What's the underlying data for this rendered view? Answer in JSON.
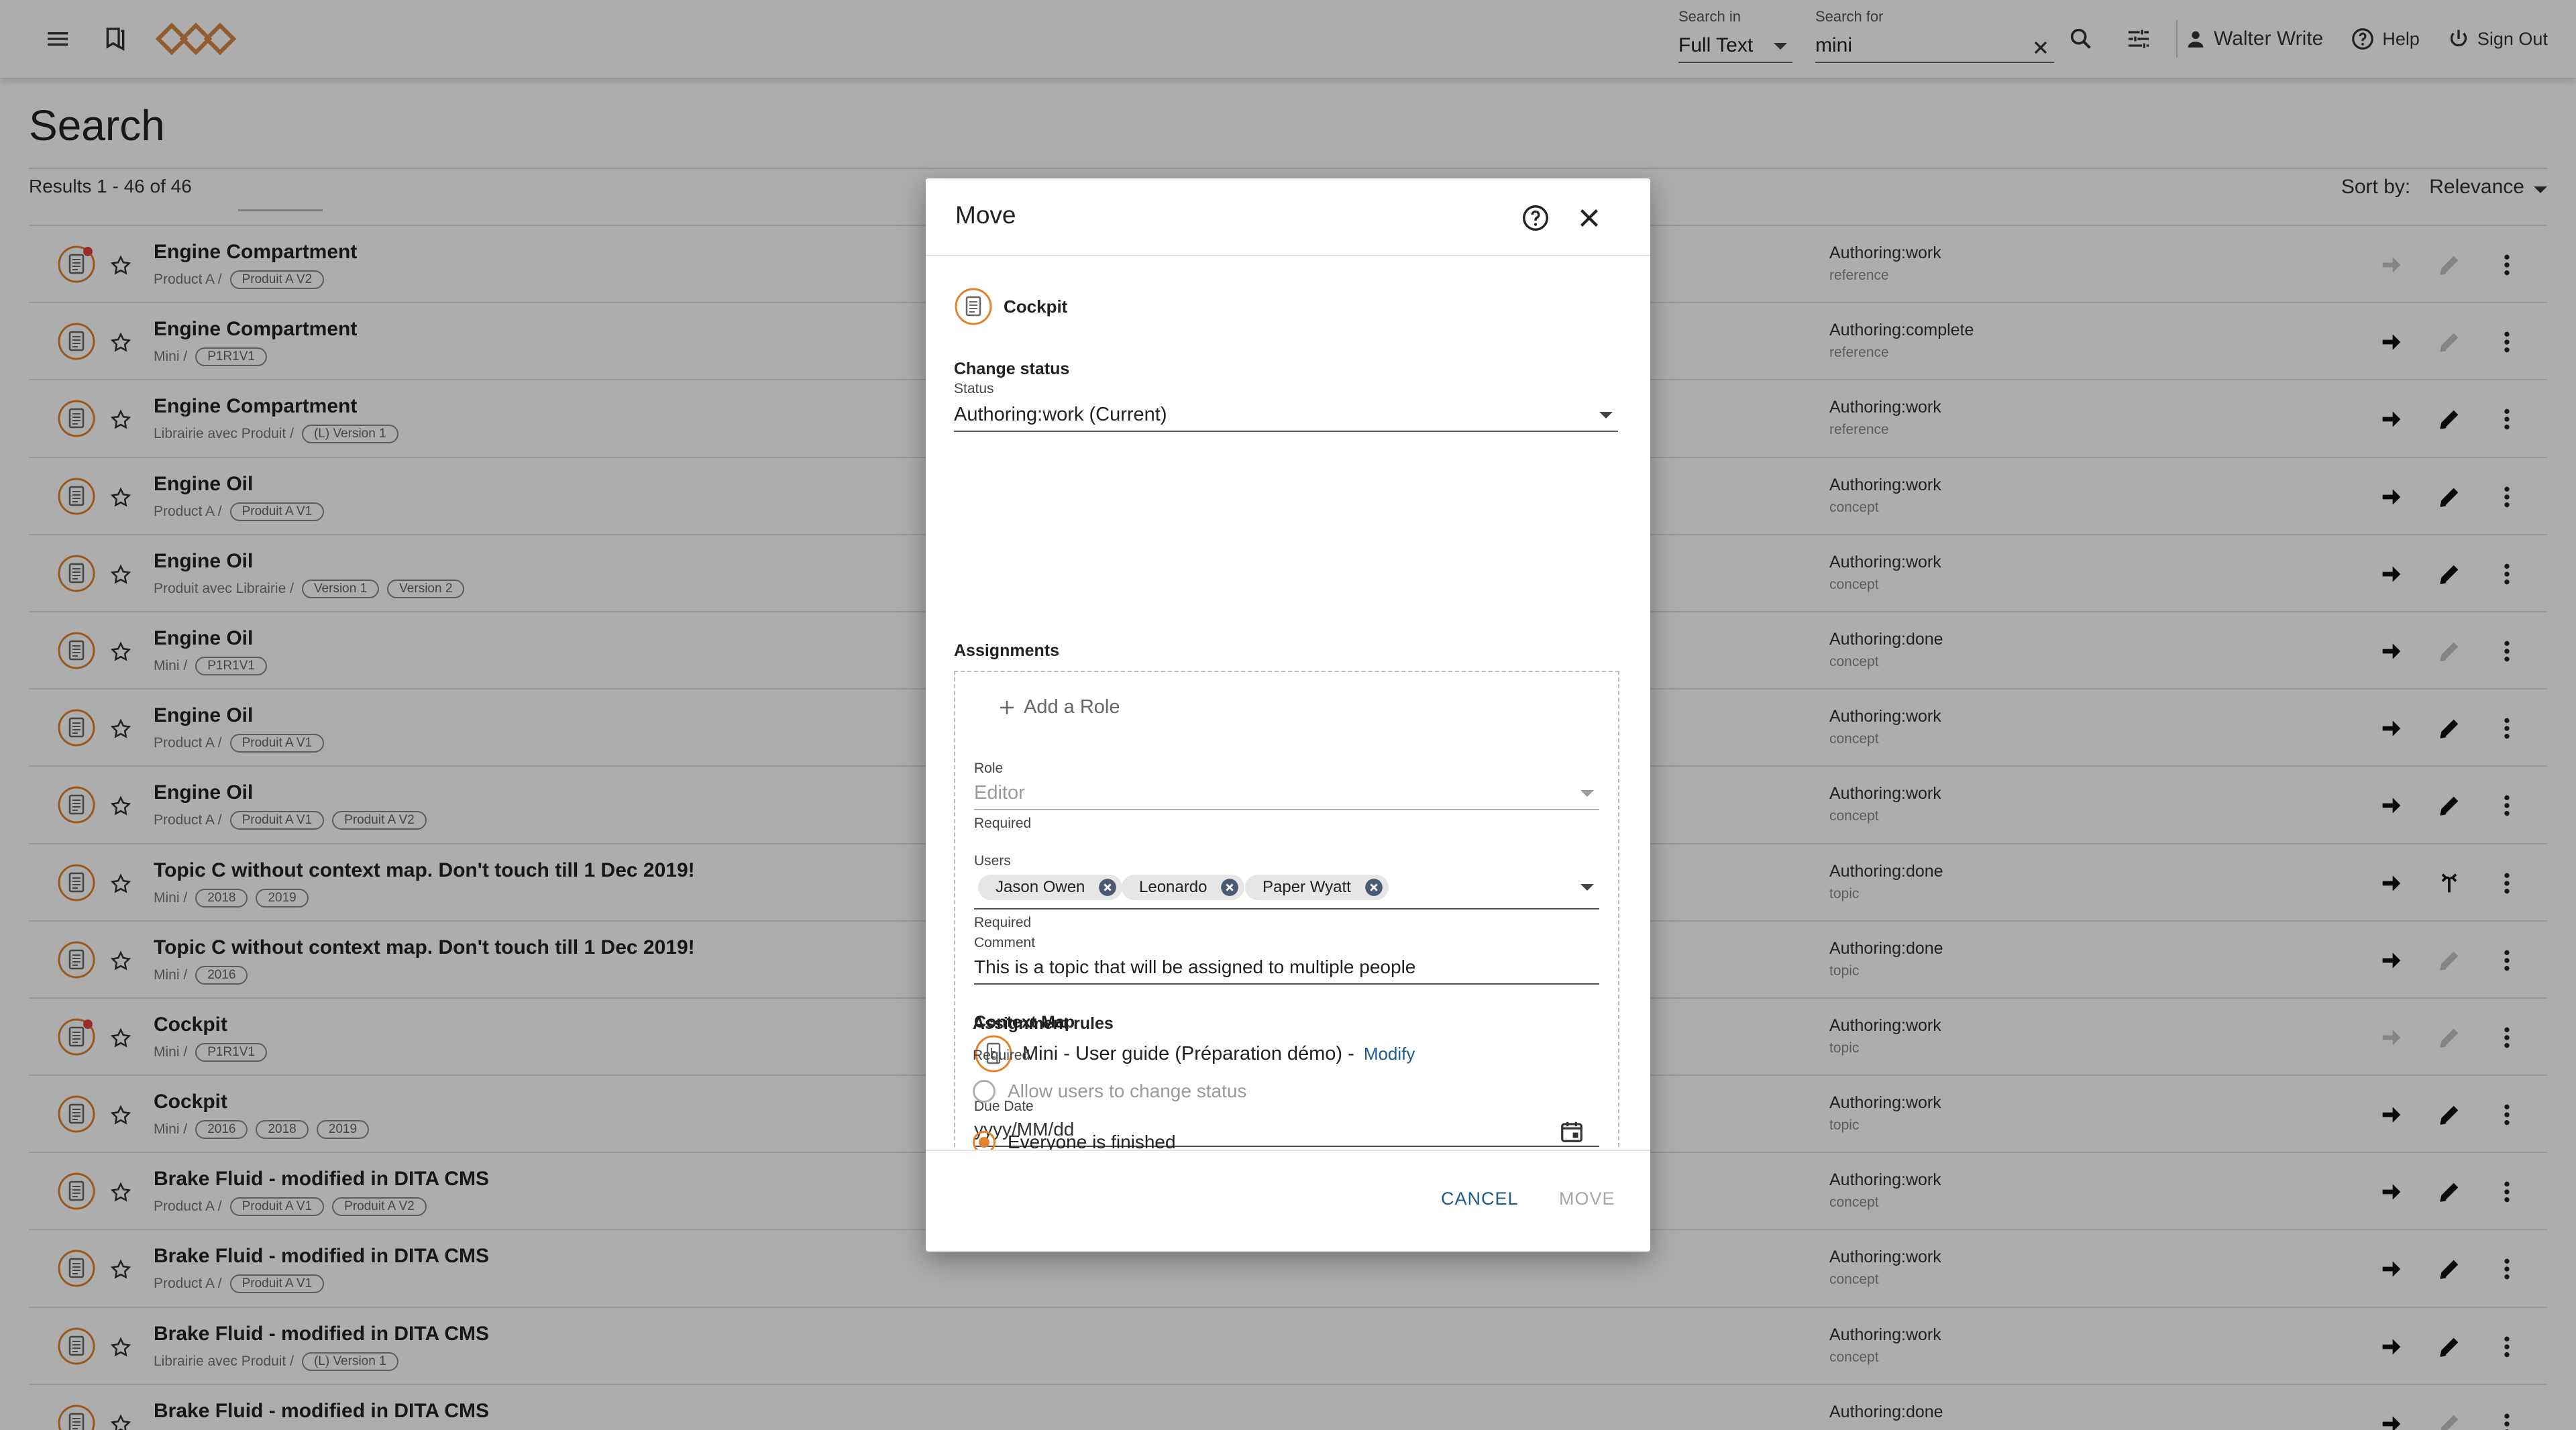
{
  "topbar": {
    "search_in_label": "Search in",
    "search_in_value": "Full Text",
    "search_for_label": "Search for",
    "search_for_value": "mini",
    "user_name": "Walter Write",
    "help_label": "Help",
    "signout_label": "Sign Out"
  },
  "page": {
    "title": "Search",
    "results_text": "Results 1 - 46 of 46",
    "sort_label": "Sort by:",
    "sort_value": "Relevance"
  },
  "rows": [
    {
      "title": "Engine Compartment",
      "path": "Product A /",
      "chips": [
        "Produit A V2"
      ],
      "status": "Authoring:work",
      "type": "reference",
      "locked": true,
      "a1_enabled": false,
      "a2_enabled": false,
      "a2_icon": "pencil"
    },
    {
      "title": "Engine Compartment",
      "path": "Mini /",
      "chips": [
        "P1R1V1"
      ],
      "status": "Authoring:complete",
      "type": "reference",
      "locked": false,
      "a1_enabled": true,
      "a2_enabled": false,
      "a2_icon": "pencil"
    },
    {
      "title": "Engine Compartment",
      "path": "Librairie avec Produit /",
      "chips": [
        "(L) Version 1"
      ],
      "status": "Authoring:work",
      "type": "reference",
      "locked": false,
      "a1_enabled": true,
      "a2_enabled": true,
      "a2_icon": "pencil"
    },
    {
      "title": "Engine Oil",
      "path": "Product A /",
      "chips": [
        "Produit A V1"
      ],
      "status": "Authoring:work",
      "type": "concept",
      "locked": false,
      "a1_enabled": true,
      "a2_enabled": true,
      "a2_icon": "pencil"
    },
    {
      "title": "Engine Oil",
      "path": "Produit avec Librairie /",
      "chips": [
        "Version 1",
        "Version 2"
      ],
      "status": "Authoring:work",
      "type": "concept",
      "locked": false,
      "a1_enabled": true,
      "a2_enabled": true,
      "a2_icon": "pencil"
    },
    {
      "title": "Engine Oil",
      "path": "Mini /",
      "chips": [
        "P1R1V1"
      ],
      "status": "Authoring:done",
      "type": "concept",
      "locked": false,
      "a1_enabled": true,
      "a2_enabled": false,
      "a2_icon": "pencil"
    },
    {
      "title": "Engine Oil",
      "path": "Product A /",
      "chips": [
        "Produit A V1"
      ],
      "status": "Authoring:work",
      "type": "concept",
      "locked": false,
      "a1_enabled": true,
      "a2_enabled": true,
      "a2_icon": "pencil"
    },
    {
      "title": "Engine Oil",
      "path": "Product A /",
      "chips": [
        "Produit A V1",
        "Produit A V2"
      ],
      "status": "Authoring:work",
      "type": "concept",
      "locked": false,
      "a1_enabled": true,
      "a2_enabled": true,
      "a2_icon": "pencil"
    },
    {
      "title": "Topic C without context map. Don't touch till 1 Dec 2019!",
      "path": "Mini /",
      "chips": [
        "2018",
        "2019"
      ],
      "status": "Authoring:done",
      "type": "topic",
      "locked": false,
      "a1_enabled": true,
      "a2_enabled": true,
      "a2_icon": "merge"
    },
    {
      "title": "Topic C without context map. Don't touch till 1 Dec 2019!",
      "path": "Mini /",
      "chips": [
        "2016"
      ],
      "status": "Authoring:done",
      "type": "topic",
      "locked": false,
      "a1_enabled": true,
      "a2_enabled": false,
      "a2_icon": "pencil"
    },
    {
      "title": "Cockpit",
      "path": "Mini /",
      "chips": [
        "P1R1V1"
      ],
      "status": "Authoring:work",
      "type": "topic",
      "locked": true,
      "a1_enabled": false,
      "a2_enabled": false,
      "a2_icon": "pencil"
    },
    {
      "title": "Cockpit",
      "path": "Mini /",
      "chips": [
        "2016",
        "2018",
        "2019"
      ],
      "status": "Authoring:work",
      "type": "topic",
      "locked": false,
      "a1_enabled": true,
      "a2_enabled": true,
      "a2_icon": "pencil"
    },
    {
      "title": "Brake Fluid - modified in DITA CMS",
      "path": "Product A /",
      "chips": [
        "Produit A V1",
        "Produit A V2"
      ],
      "status": "Authoring:work",
      "type": "concept",
      "locked": false,
      "a1_enabled": true,
      "a2_enabled": true,
      "a2_icon": "pencil"
    },
    {
      "title": "Brake Fluid - modified in DITA CMS",
      "path": "Product A /",
      "chips": [
        "Produit A V1"
      ],
      "status": "Authoring:work",
      "type": "concept",
      "locked": false,
      "a1_enabled": true,
      "a2_enabled": true,
      "a2_icon": "pencil"
    },
    {
      "title": "Brake Fluid - modified in DITA CMS",
      "path": "Librairie avec Produit /",
      "chips": [
        "(L) Version 1"
      ],
      "status": "Authoring:work",
      "type": "concept",
      "locked": false,
      "a1_enabled": true,
      "a2_enabled": true,
      "a2_icon": "pencil"
    },
    {
      "title": "Brake Fluid - modified in DITA CMS",
      "path": "",
      "chips": [],
      "status": "Authoring:done",
      "type": "",
      "locked": false,
      "a1_enabled": true,
      "a2_enabled": false,
      "a2_icon": "pencil"
    }
  ],
  "dialog": {
    "title": "Move",
    "topic_name": "Cockpit",
    "change_status_heading": "Change status",
    "status_label": "Status",
    "status_value": "Authoring:work (Current)",
    "assignments_heading": "Assignments",
    "add_role_label": "Add a Role",
    "role_label": "Role",
    "role_value": "Editor",
    "required_text": "Required",
    "users_label": "Users",
    "users": [
      "Jason Owen",
      "Leonardo",
      "Paper Wyatt"
    ],
    "comment_label": "Comment",
    "comment_value": "This is a topic that will be assigned to multiple people",
    "context_map_heading": "Context Map",
    "context_map_value": "Mini - User guide (Préparation démo) -",
    "modify_label": "Modify",
    "due_date_label": "Due Date",
    "due_date_placeholder": "yyyy/MM/dd",
    "rules_heading": "Assignment rules",
    "rule_options": [
      {
        "label": "Allow users to change status",
        "selected": false,
        "enabled": false
      },
      {
        "label": "Everyone is finished",
        "selected": true,
        "enabled": true
      }
    ],
    "cancel_label": "CANCEL",
    "move_label": "MOVE"
  },
  "colors": {
    "accent": "#e3822c",
    "link": "#1e5b8f",
    "overlay": "rgba(0,0,0,0.32)"
  }
}
